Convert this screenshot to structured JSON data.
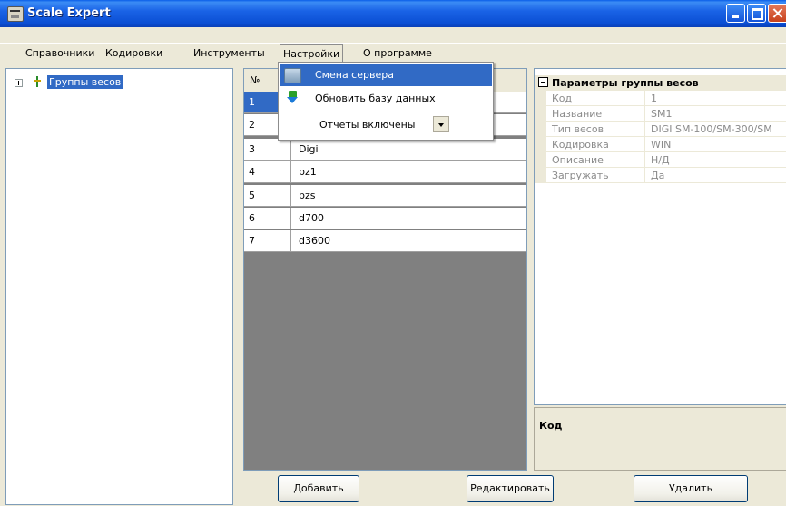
{
  "window": {
    "title": "Scale Expert"
  },
  "menu": [
    "Справочники",
    "Кодировки",
    "Инструменты",
    "Настройки",
    "О программе"
  ],
  "active_menu": "Настройки",
  "dropdown": {
    "items": [
      "Смена сервера",
      "Обновить базу данных",
      "Отчеты включены"
    ],
    "highlighted": "Смена сервера"
  },
  "tree": {
    "root_label": "Группы весов"
  },
  "grid": {
    "header_num": "№",
    "rows": [
      {
        "num": "1",
        "name": ""
      },
      {
        "num": "2",
        "name": ""
      },
      {
        "num": "3",
        "name": "Digi"
      },
      {
        "num": "4",
        "name": "bz1"
      },
      {
        "num": "5",
        "name": "bzs"
      },
      {
        "num": "6",
        "name": "d700"
      },
      {
        "num": "7",
        "name": "d3600"
      }
    ]
  },
  "properties": {
    "title": "Параметры группы весов",
    "rows": [
      {
        "key": "Код",
        "value": "1"
      },
      {
        "key": "Название",
        "value": "SM1"
      },
      {
        "key": "Тип весов",
        "value": "DIGI SM-100/SM-300/SM"
      },
      {
        "key": "Кодировка",
        "value": "WIN"
      },
      {
        "key": "Описание",
        "value": "Н/Д"
      },
      {
        "key": "Загружать",
        "value": "Да"
      }
    ]
  },
  "description": {
    "title": "Код"
  },
  "buttons": {
    "add": "Добавить",
    "edit": "Редактировать",
    "delete": "Удалить"
  },
  "colors": {
    "titlebar": "#0b4fd4",
    "selection": "#316ac5",
    "face": "#ece9d8",
    "grid_empty": "#808080"
  }
}
